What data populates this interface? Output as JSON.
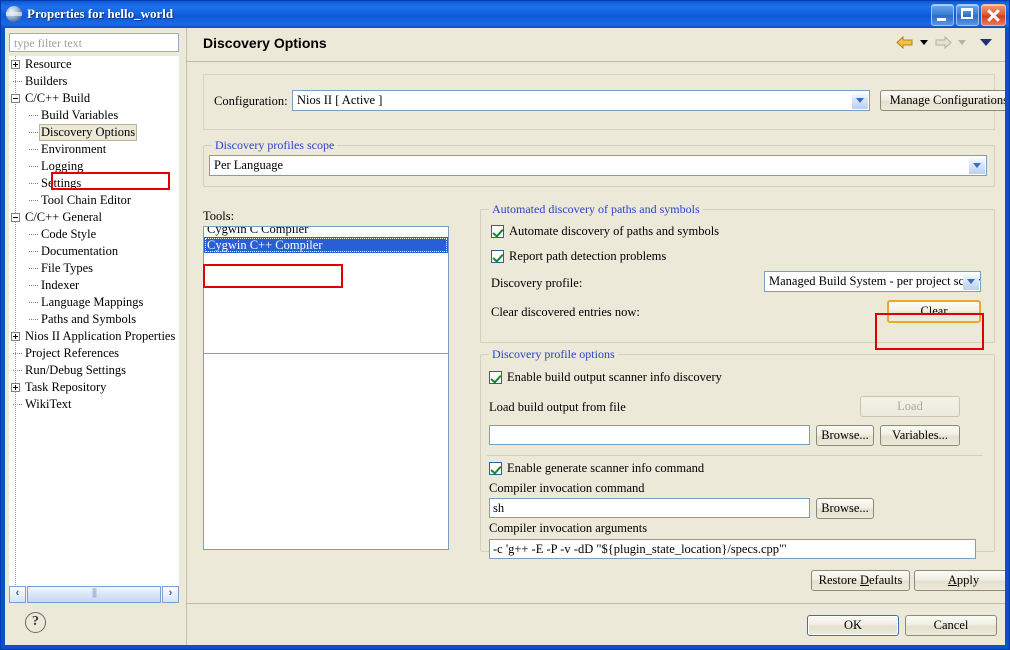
{
  "window": {
    "title": "Properties for hello_world",
    "icon": "eclipse-sphere-icon",
    "minimize_label": "Minimize",
    "maximize_label": "Maximize",
    "close_label": "Close"
  },
  "sidebar": {
    "filter": {
      "value": "",
      "placeholder": "type filter text"
    },
    "tree": [
      {
        "label": "Resource",
        "indent": 0,
        "handle": "plus",
        "selected": false
      },
      {
        "label": "Builders",
        "indent": 0,
        "handle": "none",
        "selected": false
      },
      {
        "label": "C/C++ Build",
        "indent": 0,
        "handle": "minus",
        "selected": false
      },
      {
        "label": "Build Variables",
        "indent": 1,
        "handle": "none",
        "selected": false
      },
      {
        "label": "Discovery Options",
        "indent": 1,
        "handle": "none",
        "selected": true
      },
      {
        "label": "Environment",
        "indent": 1,
        "handle": "none",
        "selected": false
      },
      {
        "label": "Logging",
        "indent": 1,
        "handle": "none",
        "selected": false
      },
      {
        "label": "Settings",
        "indent": 1,
        "handle": "none",
        "selected": false
      },
      {
        "label": "Tool Chain Editor",
        "indent": 1,
        "handle": "none",
        "selected": false
      },
      {
        "label": "C/C++ General",
        "indent": 0,
        "handle": "minus",
        "selected": false
      },
      {
        "label": "Code Style",
        "indent": 1,
        "handle": "none",
        "selected": false
      },
      {
        "label": "Documentation",
        "indent": 1,
        "handle": "none",
        "selected": false
      },
      {
        "label": "File Types",
        "indent": 1,
        "handle": "none",
        "selected": false
      },
      {
        "label": "Indexer",
        "indent": 1,
        "handle": "none",
        "selected": false
      },
      {
        "label": "Language Mappings",
        "indent": 1,
        "handle": "none",
        "selected": false
      },
      {
        "label": "Paths and Symbols",
        "indent": 1,
        "handle": "none",
        "selected": false
      },
      {
        "label": "Nios II Application Properties",
        "indent": 0,
        "handle": "plus",
        "selected": false
      },
      {
        "label": "Project References",
        "indent": 0,
        "handle": "none",
        "selected": false
      },
      {
        "label": "Run/Debug Settings",
        "indent": 0,
        "handle": "none",
        "selected": false
      },
      {
        "label": "Task Repository",
        "indent": 0,
        "handle": "plus",
        "selected": false
      },
      {
        "label": "WikiText",
        "indent": 0,
        "handle": "none",
        "selected": false
      }
    ],
    "scroll_left_label": "‹",
    "scroll_right_label": "›",
    "help_label": "?"
  },
  "header": {
    "title": "Discovery Options",
    "back_icon": "back-arrow-icon",
    "back_menu_icon": "chevron-down-icon",
    "forward_icon": "forward-arrow-icon",
    "forward_menu_icon": "chevron-down-icon",
    "view_menu_icon": "chevron-down-icon"
  },
  "configuration": {
    "label": "Configuration:",
    "value": "Nios II  [ Active ]",
    "manage_label": "Manage Configurations..."
  },
  "scope": {
    "group_label": "Discovery profiles scope",
    "value": "Per Language"
  },
  "tools": {
    "label": "Tools:",
    "items": [
      {
        "label": "Cygwin C Compiler",
        "selected": false
      },
      {
        "label": "Cygwin C++ Compiler",
        "selected": true
      }
    ]
  },
  "automated": {
    "group_label": "Automated discovery of paths and symbols",
    "automate_checkbox": {
      "label": "Automate discovery of paths and symbols",
      "checked": true
    },
    "report_checkbox": {
      "label": "Report path detection problems",
      "checked": true
    },
    "profile_label": "Discovery profile:",
    "profile_value": "Managed Build System - per project scanr",
    "clear_label": "Clear discovered entries now:",
    "clear_button": "Clear"
  },
  "profile_options": {
    "group_label": "Discovery profile options",
    "enable_scanner_checkbox": {
      "label": "Enable build output scanner info discovery",
      "checked": true
    },
    "load_file_label": "Load build output from file",
    "load_button": "Load",
    "load_button_disabled": true,
    "file_value": "",
    "browse_file_button": "Browse...",
    "variables_button": "Variables...",
    "enable_generate_checkbox": {
      "label": "Enable generate scanner info command",
      "checked": true
    },
    "command_label": "Compiler invocation command",
    "command_value": "sh",
    "browse_command_button": "Browse...",
    "arguments_label": "Compiler invocation arguments",
    "arguments_value": "-c 'g++ -E -P -v -dD \"${plugin_state_location}/specs.cpp\"'"
  },
  "footer": {
    "restore_defaults": "Restore Defaults",
    "apply": "Apply",
    "ok": "OK",
    "cancel": "Cancel"
  },
  "colors": {
    "title_bar": "#1463e0",
    "dialog_bg": "#ece9d8",
    "group_label": "#2a42c8",
    "selection": "#2a5fd4",
    "annotation": "#e00000",
    "hot_button": "#f0a824"
  }
}
